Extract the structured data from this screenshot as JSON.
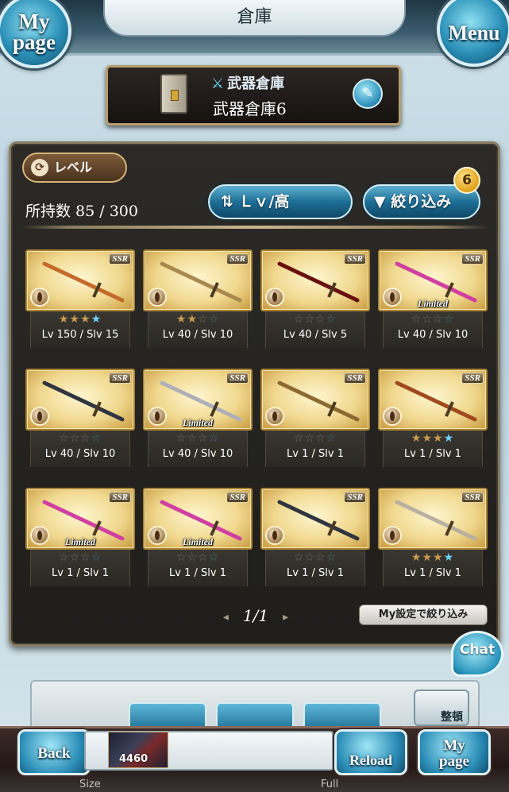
{
  "header": {
    "title": "倉庫",
    "mypage_label": "My page",
    "menu_label": "Menu"
  },
  "storage": {
    "category": "武器倉庫",
    "name": "武器倉庫6"
  },
  "toolbar": {
    "level_label": "レベル",
    "count_label": "所持数 85 / 300",
    "sort_label": "Ｌｖ/高",
    "filter_label": "絞り込み",
    "filter_badge": "6"
  },
  "weapons": [
    {
      "lv": "Lv 150 / Slv 15",
      "rarity": "SSR",
      "stars": 3,
      "blue": 1,
      "limited": "",
      "color": "#c46a2a"
    },
    {
      "lv": "Lv 40 / Slv 10",
      "rarity": "SSR",
      "stars": 2,
      "blue": 0,
      "limited": "",
      "color": "#a88a50"
    },
    {
      "lv": "Lv 40 / Slv 5",
      "rarity": "SSR",
      "stars": 0,
      "blue": 0,
      "limited": "",
      "color": "#6a1010"
    },
    {
      "lv": "Lv 40 / Slv 10",
      "rarity": "SSR",
      "stars": 0,
      "blue": 0,
      "limited": "Limited",
      "color": "#d040a0"
    },
    {
      "lv": "Lv 40 / Slv 10",
      "rarity": "SSR",
      "stars": 0,
      "blue": 0,
      "limited": "",
      "color": "#303540"
    },
    {
      "lv": "Lv 40 / Slv 10",
      "rarity": "SSR",
      "stars": 0,
      "blue": 0,
      "limited": "Limited",
      "color": "#b0b0b8"
    },
    {
      "lv": "Lv 1 / Slv 1",
      "rarity": "SSR",
      "stars": 0,
      "blue": 0,
      "limited": "",
      "color": "#8a6a30"
    },
    {
      "lv": "Lv 1 / Slv 1",
      "rarity": "SSR",
      "stars": 3,
      "blue": 1,
      "limited": "",
      "color": "#a04a20"
    },
    {
      "lv": "Lv 1 / Slv 1",
      "rarity": "SSR",
      "stars": 0,
      "blue": 0,
      "limited": "Limited",
      "color": "#d040a0"
    },
    {
      "lv": "Lv 1 / Slv 1",
      "rarity": "SSR",
      "stars": 0,
      "blue": 0,
      "limited": "Limited",
      "color": "#d040a0"
    },
    {
      "lv": "Lv 1 / Slv 1",
      "rarity": "SSR",
      "stars": 0,
      "blue": 0,
      "limited": "",
      "color": "#303540"
    },
    {
      "lv": "Lv 1 / Slv 1",
      "rarity": "SSR",
      "stars": 3,
      "blue": 1,
      "limited": "",
      "color": "#b8b0a0"
    }
  ],
  "pager": {
    "page": "1/1",
    "mysetting_label": "My設定で絞り込み"
  },
  "chat_label": "Chat",
  "lower": {
    "sort_label": "整頓"
  },
  "footer": {
    "back_label": "Back",
    "reload_label": "Reload",
    "mypage_label": "My page",
    "thumb_value": "4460",
    "size_label": "Size",
    "full_label": "Full"
  }
}
